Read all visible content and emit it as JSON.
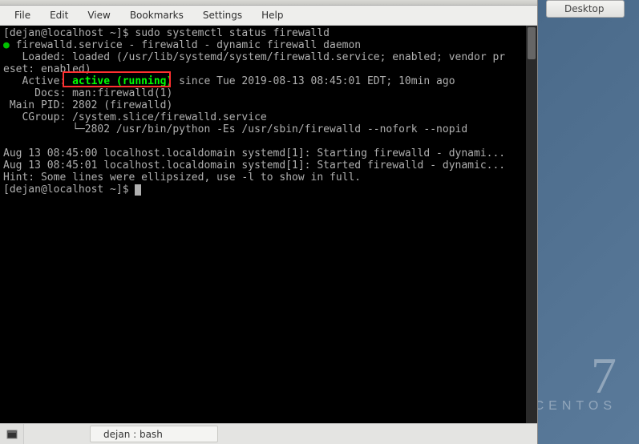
{
  "desktop": {
    "button_label": "Desktop",
    "branding_number": "7",
    "branding_text": "CENTOS"
  },
  "menubar": {
    "items": [
      "File",
      "Edit",
      "View",
      "Bookmarks",
      "Settings",
      "Help"
    ]
  },
  "terminal": {
    "prompt1_user": "[dejan@localhost ~]$ ",
    "cmd1": "sudo systemctl status firewalld",
    "bullet": "●",
    "svc_line": " firewalld.service - firewalld - dynamic firewall daemon",
    "loaded_line": "   Loaded: loaded (/usr/lib/systemd/system/firewalld.service; enabled; vendor pr",
    "eset_line": "eset: enabled)",
    "active_prefix": "   Active: ",
    "active_status": "active (running)",
    "active_suffix": " since Tue 2019-08-13 08:45:01 EDT; 10min ago",
    "docs_line": "     Docs: man:firewalld(1)",
    "pid_line": " Main PID: 2802 (firewalld)",
    "cgroup1": "   CGroup: /system.slice/firewalld.service",
    "cgroup2": "           └─2802 /usr/bin/python -Es /usr/sbin/firewalld --nofork --nopid",
    "blank": "",
    "log1": "Aug 13 08:45:00 localhost.localdomain systemd[1]: Starting firewalld - dynami...",
    "log2": "Aug 13 08:45:01 localhost.localdomain systemd[1]: Started firewalld - dynamic...",
    "hint": "Hint: Some lines were ellipsized, use -l to show in full.",
    "prompt2_user": "[dejan@localhost ~]$ "
  },
  "taskbar": {
    "tab_label": "dejan : bash"
  }
}
